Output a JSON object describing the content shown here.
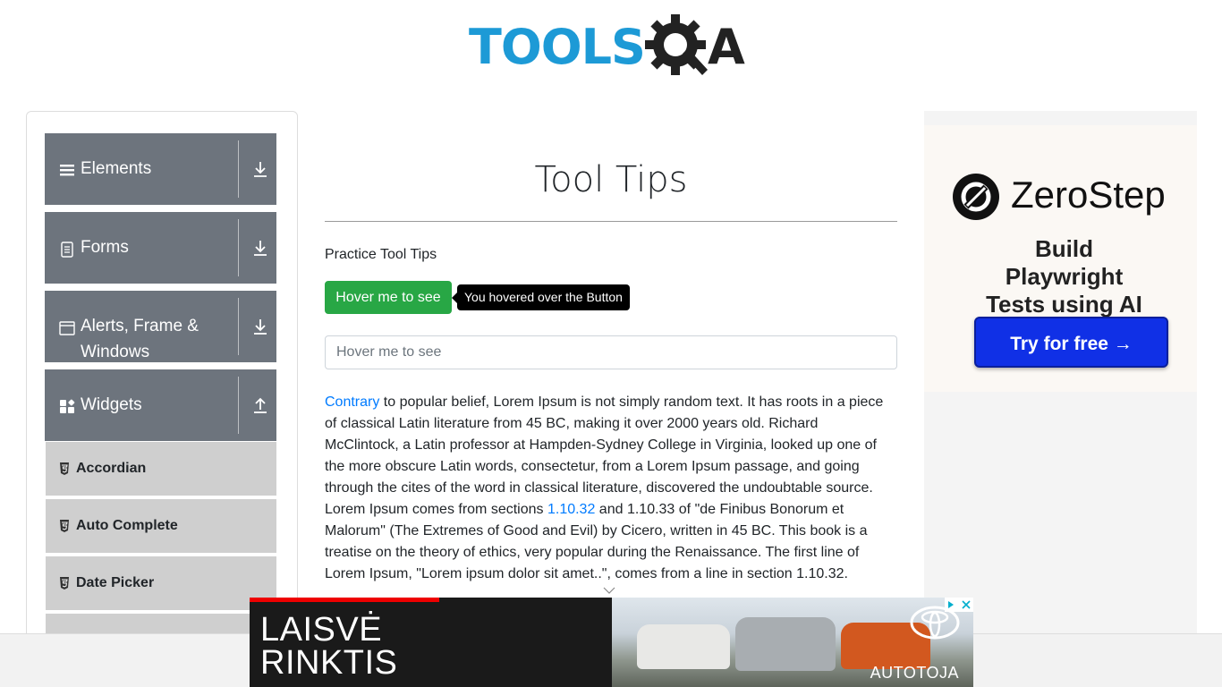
{
  "header": {
    "logo_text_1": "TOOLS",
    "logo_text_2": "A",
    "brand_blue": "#1d9ad6"
  },
  "sidebar": {
    "groups": [
      {
        "label": "Elements",
        "icon": "list-icon",
        "arrow": "download-icon"
      },
      {
        "label": "Forms",
        "icon": "form-icon",
        "arrow": "download-icon"
      },
      {
        "label": "Alerts, Frame & Windows",
        "icon": "window-icon",
        "arrow": "download-icon"
      },
      {
        "label": "Widgets",
        "icon": "widgets-icon",
        "arrow": "upload-icon"
      }
    ],
    "sub_items": [
      {
        "label": "Accordian",
        "icon": "html5-icon"
      },
      {
        "label": "Auto Complete",
        "icon": "html5-icon"
      },
      {
        "label": "Date Picker",
        "icon": "html5-icon"
      }
    ],
    "group_color": "#6d747d",
    "subitem_color": "#cfcfcf"
  },
  "main": {
    "title": "Tool Tips",
    "practice_label": "Practice Tool Tips",
    "hover_button": "Hover me to see",
    "tooltip_text": "You hovered over the Button",
    "input_placeholder": "Hover me to see",
    "para": {
      "link1": "Contrary",
      "text1": " to popular belief, Lorem Ipsum is not simply random text. It has roots in a piece of classical Latin literature from 45 BC, making it over 2000 years old. Richard McClintock, a Latin professor at Hampden-Sydney College in Virginia, looked up one of the more obscure Latin words, consectetur, from a Lorem Ipsum passage, and going through the cites of the word in classical literature, discovered the undoubtable source. Lorem Ipsum comes from sections ",
      "link2": "1.10.32",
      "text2": " and 1.10.33 of \"de Finibus Bonorum et Malorum\" (The Extremes of Good and Evil) by Cicero, written in 45 BC. This book is a treatise on the theory of ethics, very popular during the Renaissance. The first line of Lorem Ipsum, \"Lorem ipsum dolor sit amet..\", comes from a line in section 1.10.32."
    },
    "button_color": "#28a745"
  },
  "ad_right": {
    "brand": "ZeroStep",
    "tagline": "Build Playwright Tests using AI",
    "cta": "Try for free →",
    "cta_color": "#1030e6"
  },
  "ad_bottom": {
    "headline_1": "LAISVĖ",
    "headline_2": "RINKTIS",
    "dealer": "AUTOTOJA"
  }
}
